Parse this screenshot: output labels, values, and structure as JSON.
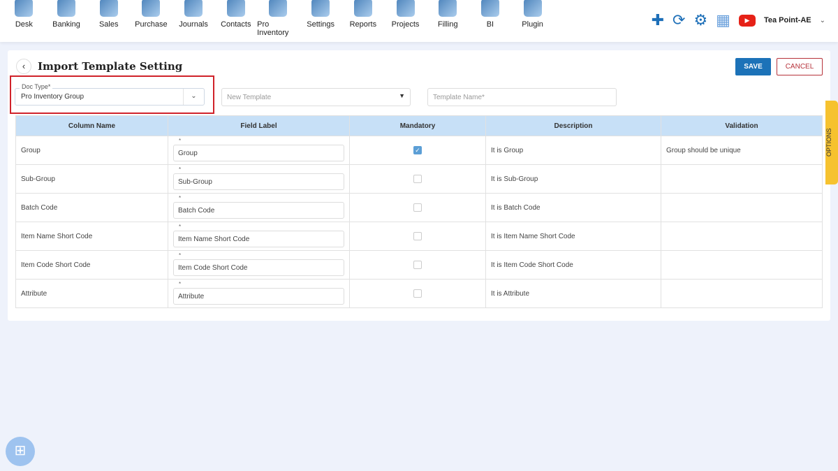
{
  "nav": [
    "Desk",
    "Banking",
    "Sales",
    "Purchase",
    "Journals",
    "Contacts",
    "Pro Inventory",
    "Settings",
    "Reports",
    "Projects",
    "Filling",
    "BI",
    "Plugin"
  ],
  "company": "Tea Point-AE",
  "page": {
    "title": "Import Template Setting",
    "save": "SAVE",
    "cancel": "CANCEL",
    "options": "OPTIONS"
  },
  "form": {
    "doc_type_label": "Doc Type*",
    "doc_type_value": "Pro Inventory Group",
    "template_placeholder": "New Template",
    "template_name_placeholder": "Template Name*"
  },
  "table": {
    "headers": [
      "Column Name",
      "Field Label",
      "Mandatory",
      "Description",
      "Validation"
    ],
    "rows": [
      {
        "column": "Group",
        "label": "Group",
        "mandatory": true,
        "desc": "It is Group",
        "validation": "Group should be unique"
      },
      {
        "column": "Sub-Group",
        "label": "Sub-Group",
        "mandatory": false,
        "desc": "It is Sub-Group",
        "validation": ""
      },
      {
        "column": "Batch Code",
        "label": "Batch Code",
        "mandatory": false,
        "desc": "It is Batch Code",
        "validation": ""
      },
      {
        "column": "Item Name Short Code",
        "label": "Item Name Short Code",
        "mandatory": false,
        "desc": "It is Item Name Short Code",
        "validation": ""
      },
      {
        "column": "Item Code Short Code",
        "label": "Item Code Short Code",
        "mandatory": false,
        "desc": "It is Item Code Short Code",
        "validation": ""
      },
      {
        "column": "Attribute",
        "label": "Attribute",
        "mandatory": false,
        "desc": "It is Attribute",
        "validation": ""
      }
    ]
  },
  "colors": {
    "accent": "#1c72b8",
    "highlight": "#d0222a",
    "header_bg": "#c7e0f7",
    "options_tab": "#f6c22f"
  }
}
